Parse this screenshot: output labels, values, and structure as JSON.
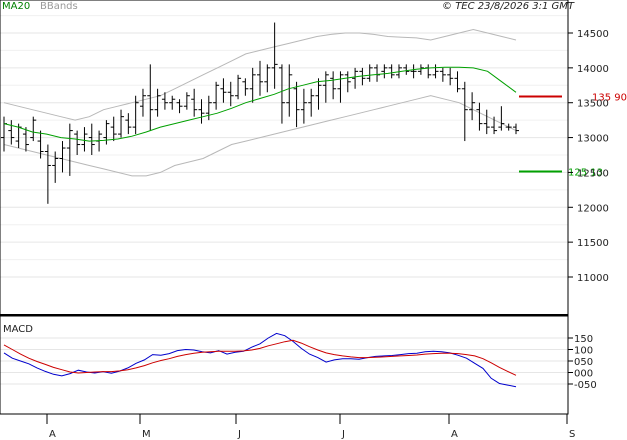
{
  "header": {
    "indicator_ma": "MA20",
    "indicator_bbands": "BBands",
    "copyright": "© TEC 23/8/2026 3:1 GMT"
  },
  "colors": {
    "ma_label": "#008000",
    "bbands_label": "#999999",
    "bar": "#000000",
    "ma_line": "#00a000",
    "bbands": "#b8b8b8",
    "resistance": "#cc0000",
    "support": "#00a000",
    "macd_line": "#0000cc",
    "signal_line": "#cc0000",
    "grid": "#e6e6e6",
    "frame": "#000000"
  },
  "chart_data": [
    {
      "type": "ohlc",
      "title": "",
      "ylim": [
        10500,
        14800
      ],
      "yticks": [
        11000,
        11500,
        12000,
        12500,
        13000,
        13500,
        14000,
        14500
      ],
      "ytick_labels": [
        "11000",
        "11500",
        "12000",
        "12500",
        "13000",
        "13500",
        "14000",
        "14500"
      ],
      "x_months": [
        "A",
        "M",
        "J",
        "J",
        "A",
        "S"
      ],
      "grid": true,
      "series": [
        {
          "name": "MA20",
          "values": [
            13200,
            13150,
            13080,
            13050,
            13000,
            12980,
            12950,
            12960,
            12980,
            13020,
            13080,
            13150,
            13200,
            13250,
            13300,
            13350,
            13420,
            13500,
            13560,
            13620,
            13700,
            13750,
            13800,
            13820,
            13850,
            13880,
            13900,
            13920,
            13950,
            13980,
            14000,
            14010,
            14010,
            14000,
            13950,
            13800,
            13650
          ]
        },
        {
          "name": "BBands upper",
          "values": [
            13500,
            13450,
            13400,
            13350,
            13300,
            13250,
            13300,
            13400,
            13450,
            13500,
            13550,
            13600,
            13700,
            13800,
            13900,
            14000,
            14100,
            14200,
            14250,
            14300,
            14350,
            14400,
            14450,
            14480,
            14500,
            14500,
            14480,
            14450,
            14440,
            14430,
            14400,
            14450,
            14500,
            14550,
            14500,
            14450,
            14400
          ]
        },
        {
          "name": "BBands lower",
          "values": [
            12900,
            12850,
            12800,
            12750,
            12700,
            12650,
            12600,
            12550,
            12500,
            12450,
            12450,
            12500,
            12600,
            12650,
            12700,
            12800,
            12900,
            12950,
            13000,
            13050,
            13100,
            13150,
            13200,
            13250,
            13300,
            13350,
            13400,
            13450,
            13500,
            13550,
            13600,
            13550,
            13500,
            13400,
            13300,
            13200,
            13100
          ]
        }
      ],
      "levels": [
        {
          "name": "resistance",
          "value": 13590,
          "label": "135 90"
        },
        {
          "name": "support",
          "value": 12513,
          "label": "125 13"
        }
      ],
      "price_bars": [
        {
          "h": 13300,
          "l": 12800,
          "o": 13000,
          "c": 13200
        },
        {
          "h": 13250,
          "l": 12900,
          "o": 13100,
          "c": 13000
        },
        {
          "h": 13200,
          "l": 12850,
          "o": 12950,
          "c": 13150
        },
        {
          "h": 13150,
          "l": 12800,
          "o": 13050,
          "c": 12900
        },
        {
          "h": 13300,
          "l": 12950,
          "o": 13000,
          "c": 13250
        },
        {
          "h": 13100,
          "l": 12700,
          "o": 12950,
          "c": 12800
        },
        {
          "h": 12900,
          "l": 12050,
          "o": 12800,
          "c": 12600
        },
        {
          "h": 12800,
          "l": 12350,
          "o": 12600,
          "c": 12700
        },
        {
          "h": 12950,
          "l": 12500,
          "o": 12700,
          "c": 12850
        },
        {
          "h": 13200,
          "l": 12450,
          "o": 12850,
          "c": 13100
        },
        {
          "h": 13100,
          "l": 12750,
          "o": 13050,
          "c": 12900
        },
        {
          "h": 13150,
          "l": 12800,
          "o": 12900,
          "c": 13050
        },
        {
          "h": 13200,
          "l": 12750,
          "o": 13000,
          "c": 12900
        },
        {
          "h": 13100,
          "l": 12800,
          "o": 12950,
          "c": 13050
        },
        {
          "h": 13250,
          "l": 12900,
          "o": 13000,
          "c": 13200
        },
        {
          "h": 13300,
          "l": 12950,
          "o": 13150,
          "c": 13050
        },
        {
          "h": 13400,
          "l": 13000,
          "o": 13050,
          "c": 13300
        },
        {
          "h": 13350,
          "l": 13050,
          "o": 13250,
          "c": 13150
        },
        {
          "h": 13600,
          "l": 13050,
          "o": 13150,
          "c": 13500
        },
        {
          "h": 13700,
          "l": 13300,
          "o": 13450,
          "c": 13600
        },
        {
          "h": 14050,
          "l": 13100,
          "o": 13600,
          "c": 13400
        },
        {
          "h": 13700,
          "l": 13300,
          "o": 13400,
          "c": 13600
        },
        {
          "h": 13650,
          "l": 13400,
          "o": 13550,
          "c": 13500
        },
        {
          "h": 13600,
          "l": 13400,
          "o": 13500,
          "c": 13550
        },
        {
          "h": 13550,
          "l": 13350,
          "o": 13500,
          "c": 13450
        },
        {
          "h": 13650,
          "l": 13400,
          "o": 13450,
          "c": 13600
        },
        {
          "h": 13700,
          "l": 13300,
          "o": 13550,
          "c": 13400
        },
        {
          "h": 13550,
          "l": 13200,
          "o": 13400,
          "c": 13350
        },
        {
          "h": 13600,
          "l": 13250,
          "o": 13350,
          "c": 13500
        },
        {
          "h": 13800,
          "l": 13400,
          "o": 13500,
          "c": 13750
        },
        {
          "h": 13850,
          "l": 13500,
          "o": 13700,
          "c": 13650
        },
        {
          "h": 13800,
          "l": 13450,
          "o": 13650,
          "c": 13600
        },
        {
          "h": 13900,
          "l": 13550,
          "o": 13600,
          "c": 13850
        },
        {
          "h": 13850,
          "l": 13600,
          "o": 13800,
          "c": 13700
        },
        {
          "h": 14000,
          "l": 13500,
          "o": 13700,
          "c": 13900
        },
        {
          "h": 14100,
          "l": 13600,
          "o": 13900,
          "c": 13800
        },
        {
          "h": 14050,
          "l": 13650,
          "o": 13800,
          "c": 14000
        },
        {
          "h": 14650,
          "l": 13700,
          "o": 14000,
          "c": 14050
        },
        {
          "h": 14050,
          "l": 13200,
          "o": 14000,
          "c": 13500
        },
        {
          "h": 14050,
          "l": 13300,
          "o": 13500,
          "c": 13900
        },
        {
          "h": 13800,
          "l": 13150,
          "o": 13700,
          "c": 13400
        },
        {
          "h": 13700,
          "l": 13200,
          "o": 13400,
          "c": 13500
        },
        {
          "h": 13700,
          "l": 13300,
          "o": 13500,
          "c": 13600
        },
        {
          "h": 13850,
          "l": 13400,
          "o": 13600,
          "c": 13750
        },
        {
          "h": 13950,
          "l": 13500,
          "o": 13750,
          "c": 13900
        },
        {
          "h": 13950,
          "l": 13550,
          "o": 13850,
          "c": 13700
        },
        {
          "h": 13950,
          "l": 13500,
          "o": 13700,
          "c": 13900
        },
        {
          "h": 13950,
          "l": 13650,
          "o": 13900,
          "c": 13800
        },
        {
          "h": 14000,
          "l": 13700,
          "o": 13850,
          "c": 13950
        },
        {
          "h": 14000,
          "l": 13750,
          "o": 13950,
          "c": 13850
        },
        {
          "h": 14050,
          "l": 13800,
          "o": 13850,
          "c": 14000
        },
        {
          "h": 14050,
          "l": 13800,
          "o": 14000,
          "c": 13900
        },
        {
          "h": 14050,
          "l": 13850,
          "o": 13950,
          "c": 14000
        },
        {
          "h": 14050,
          "l": 13850,
          "o": 14000,
          "c": 13900
        },
        {
          "h": 14050,
          "l": 13850,
          "o": 13900,
          "c": 14000
        },
        {
          "h": 14050,
          "l": 13900,
          "o": 14000,
          "c": 13950
        },
        {
          "h": 14050,
          "l": 13850,
          "o": 13950,
          "c": 13950
        },
        {
          "h": 14050,
          "l": 13900,
          "o": 13950,
          "c": 14000
        },
        {
          "h": 14050,
          "l": 13850,
          "o": 14000,
          "c": 13900
        },
        {
          "h": 14050,
          "l": 13850,
          "o": 13900,
          "c": 13950
        },
        {
          "h": 14000,
          "l": 13800,
          "o": 13950,
          "c": 13900
        },
        {
          "h": 14000,
          "l": 13750,
          "o": 13900,
          "c": 13850
        },
        {
          "h": 13950,
          "l": 13650,
          "o": 13850,
          "c": 13700
        },
        {
          "h": 13800,
          "l": 12950,
          "o": 13700,
          "c": 13400
        },
        {
          "h": 13650,
          "l": 13250,
          "o": 13400,
          "c": 13500
        },
        {
          "h": 13500,
          "l": 13100,
          "o": 13400,
          "c": 13200
        },
        {
          "h": 13400,
          "l": 13050,
          "o": 13200,
          "c": 13150
        },
        {
          "h": 13300,
          "l": 13050,
          "o": 13150,
          "c": 13100
        },
        {
          "h": 13450,
          "l": 13100,
          "o": 13150,
          "c": 13200
        },
        {
          "h": 13200,
          "l": 13100,
          "o": 13150,
          "c": 13150
        },
        {
          "h": 13200,
          "l": 13050,
          "o": 13150,
          "c": 13100
        }
      ]
    },
    {
      "type": "line",
      "title": "MACD",
      "ylim": [
        -85,
        235
      ],
      "yticks": [
        -50,
        0,
        50,
        100,
        150
      ],
      "ytick_labels": [
        "-050",
        "000",
        "050",
        "100",
        "150"
      ],
      "grid": true,
      "series": [
        {
          "name": "MACD",
          "values": [
            85,
            62,
            50,
            38,
            20,
            5,
            -8,
            -15,
            -5,
            10,
            2,
            -2,
            4,
            -3,
            6,
            20,
            40,
            55,
            78,
            75,
            82,
            95,
            100,
            98,
            90,
            85,
            95,
            80,
            88,
            92,
            110,
            125,
            150,
            170,
            160,
            135,
            105,
            80,
            65,
            45,
            55,
            60,
            60,
            58,
            65,
            70,
            72,
            74,
            78,
            82,
            84,
            90,
            92,
            90,
            85,
            75,
            62,
            40,
            18,
            -25,
            -48,
            -55,
            -62
          ]
        },
        {
          "name": "Signal",
          "values": [
            120,
            100,
            80,
            62,
            48,
            35,
            22,
            12,
            2,
            -2,
            0,
            2,
            4,
            4,
            7,
            12,
            20,
            30,
            42,
            52,
            60,
            70,
            78,
            84,
            88,
            90,
            92,
            92,
            92,
            94,
            98,
            105,
            116,
            125,
            134,
            140,
            128,
            112,
            98,
            85,
            78,
            72,
            68,
            65,
            65,
            66,
            68,
            70,
            72,
            74,
            76,
            80,
            82,
            84,
            84,
            82,
            78,
            72,
            60,
            42,
            22,
            5,
            -12
          ]
        }
      ]
    }
  ]
}
